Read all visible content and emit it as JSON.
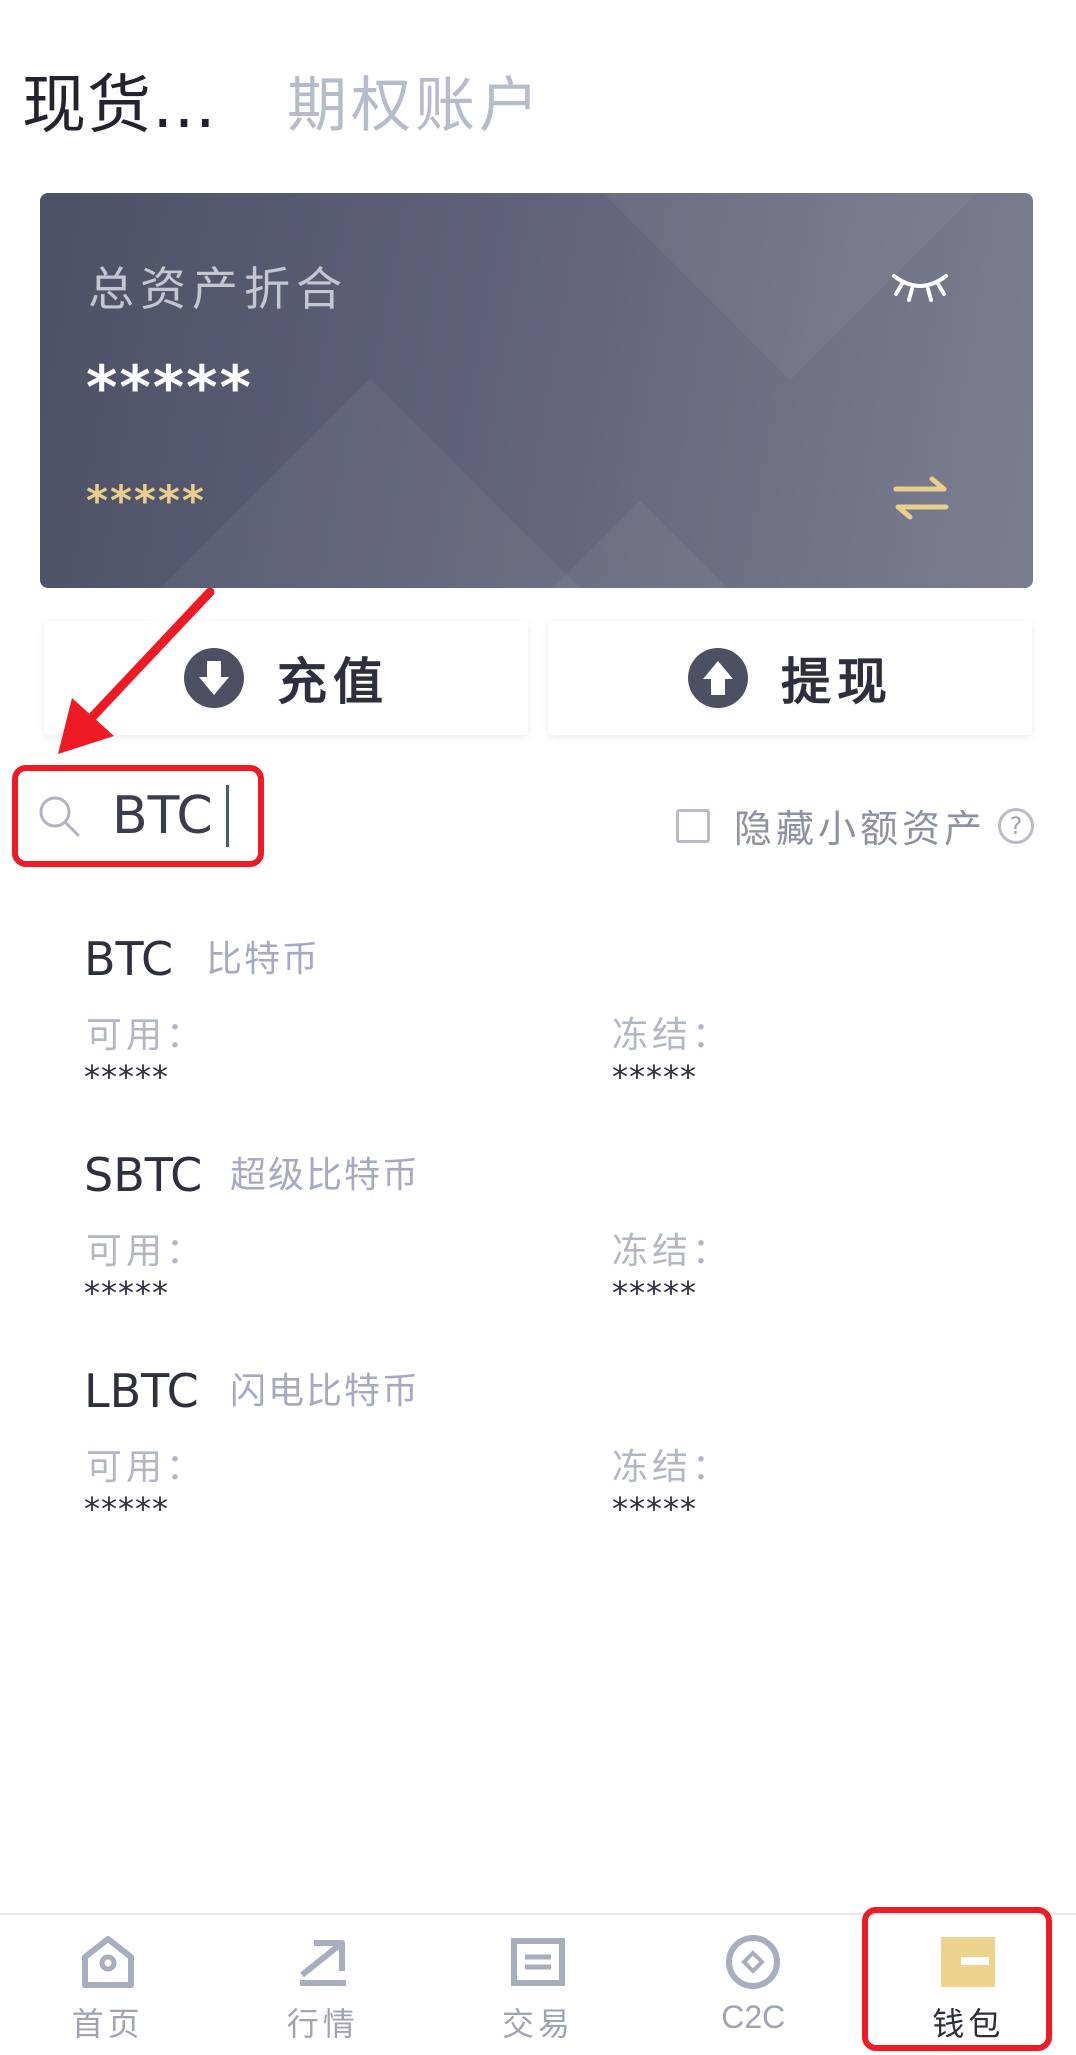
{
  "top_tabs": {
    "active": "现货…",
    "inactive": "期权账户"
  },
  "asset_card": {
    "title": "总资产折合",
    "amount": "*****",
    "sub_amount": "*****"
  },
  "actions": {
    "deposit": "充值",
    "withdraw": "提现"
  },
  "search": {
    "value": "BTC",
    "placeholder": ""
  },
  "hide_small": {
    "label": "隐藏小额资产",
    "help": "?"
  },
  "assets": [
    {
      "symbol": "BTC",
      "name": "比特币",
      "available_label": "可用：",
      "frozen_label": "冻结：",
      "available": "*****",
      "frozen": "*****"
    },
    {
      "symbol": "SBTC",
      "name": "超级比特币",
      "available_label": "可用：",
      "frozen_label": "冻结：",
      "available": "*****",
      "frozen": "*****"
    },
    {
      "symbol": "LBTC",
      "name": "闪电比特币",
      "available_label": "可用：",
      "frozen_label": "冻结：",
      "available": "*****",
      "frozen": "*****"
    }
  ],
  "nav": [
    {
      "label": "首页",
      "icon": "home-icon"
    },
    {
      "label": "行情",
      "icon": "market-icon"
    },
    {
      "label": "交易",
      "icon": "trade-icon"
    },
    {
      "label": "C2C",
      "icon": "c2c-icon"
    },
    {
      "label": "钱包",
      "icon": "wallet-icon",
      "active": true
    }
  ],
  "colors": {
    "accent_gold": "#e8cf8d",
    "annotation_red": "#ee1a25",
    "card_dark": "#4d5166"
  }
}
